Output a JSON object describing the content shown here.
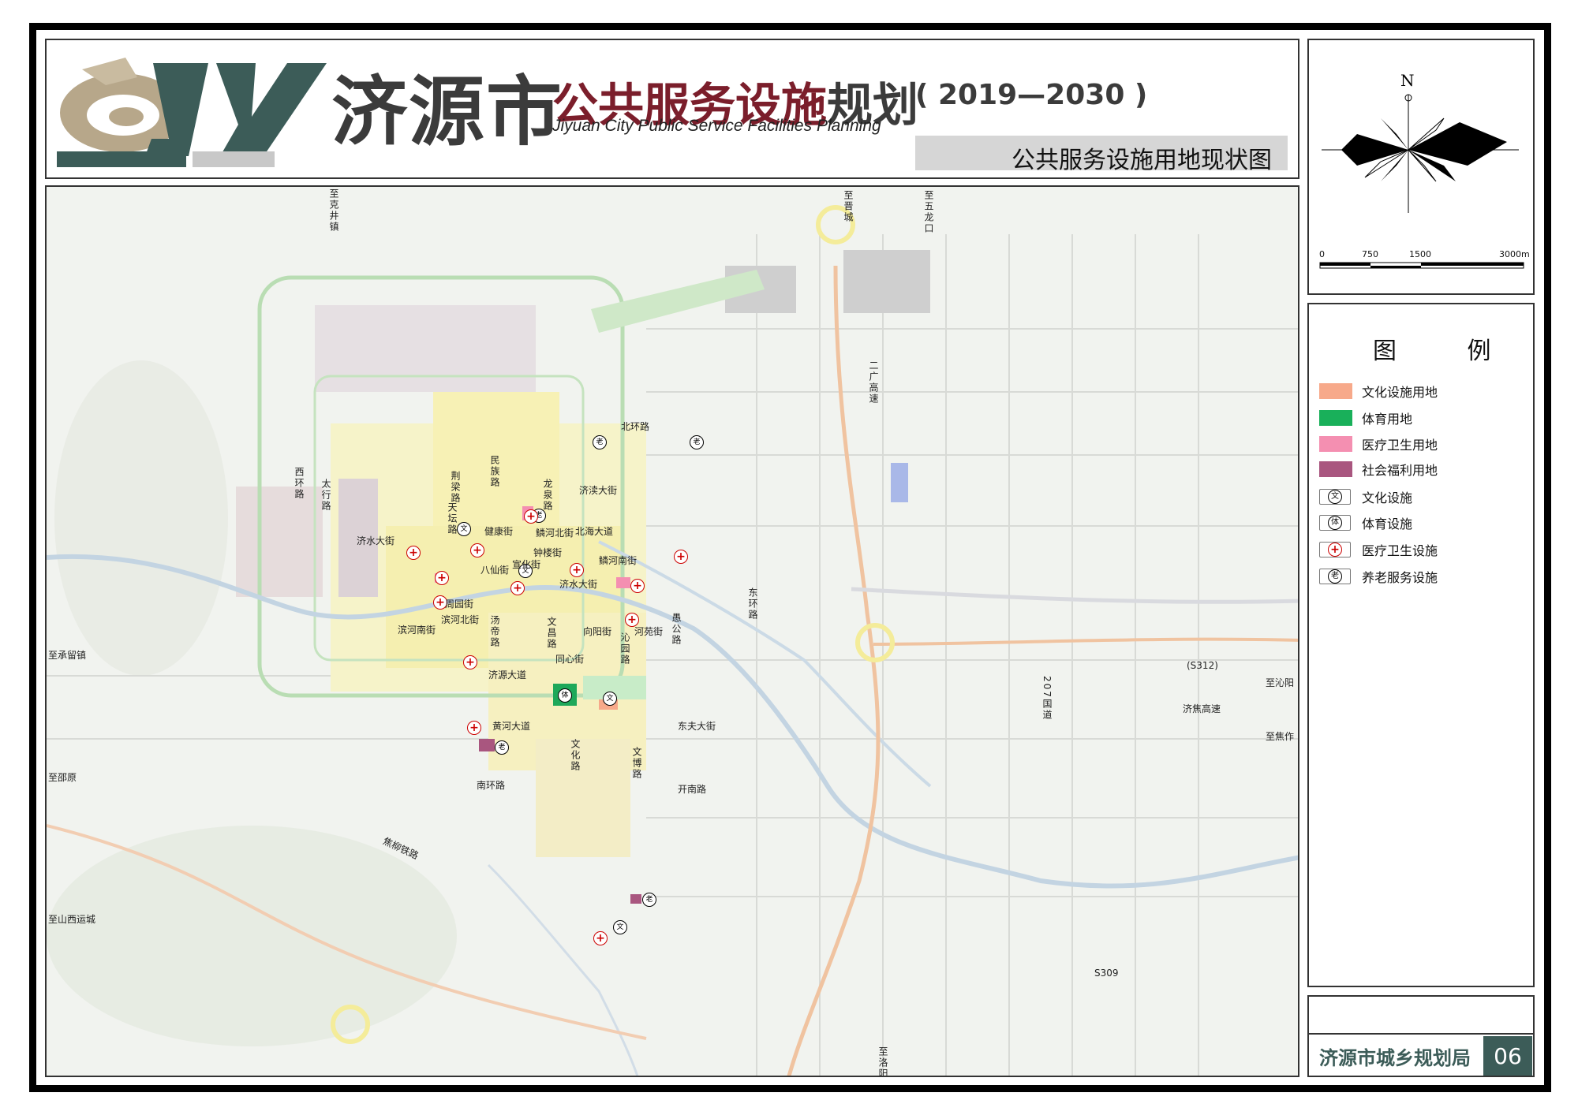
{
  "header": {
    "logo_text": "济源市",
    "title_main": "公共服务设施",
    "title_suffix": "规划",
    "title_years": "( 2019—2030 )",
    "title_en": "Jiyuan City Public Service Facilities Planning",
    "subtitle": "公共服务设施用地现状图"
  },
  "compass": {
    "north": "N",
    "scale_ticks": [
      "0",
      "750",
      "1500",
      "3000m"
    ]
  },
  "legend": {
    "title": "图 例",
    "items": [
      {
        "label": "文化设施用地",
        "color": "#f7a98a",
        "kind": "area"
      },
      {
        "label": "体育用地",
        "color": "#19b05a",
        "kind": "area"
      },
      {
        "label": "医疗卫生用地",
        "color": "#f48fb1",
        "kind": "area"
      },
      {
        "label": "社会福利用地",
        "color": "#a9567f",
        "kind": "area"
      },
      {
        "label": "文化设施",
        "glyph": "文",
        "kind": "symbol"
      },
      {
        "label": "体育设施",
        "glyph": "体",
        "kind": "symbol"
      },
      {
        "label": "医疗卫生设施",
        "glyph": "+",
        "kind": "symbol"
      },
      {
        "label": "养老服务设施",
        "glyph": "老",
        "kind": "symbol"
      }
    ]
  },
  "footer": {
    "agency": "济源市城乡规划局",
    "page_number": "06"
  },
  "map": {
    "labels": {
      "to_kejing": "至克井镇",
      "to_jincheng": "至晋城",
      "to_wulongkou": "至五龙口",
      "to_chengliu": "至承留镇",
      "to_qinyang": "至沁阳",
      "to_jiaozuo": "至焦作",
      "to_shaoyuan": "至邵原",
      "to_yuncheng": "至山西运城",
      "north_ring": "北环路",
      "south_ring": "南环路",
      "west_ring": "西环路",
      "east_ring": "东环路",
      "taihang": "太行路",
      "jishui": "济水大街",
      "jidu": "济渎大街",
      "beihai": "北海大道",
      "jiankang": "健康街",
      "zhonglou": "钟楼街",
      "bahe_n": "鳞河北街",
      "bahe_s": "鳞河南街",
      "xuanhua": "宣化街",
      "baxian": "八仙街",
      "jishui2": "济水大街",
      "binhe_n": "滨河北街",
      "binhe_s": "滨河南街",
      "zhouyuan": "周园街",
      "jiyuan": "济源大道",
      "huanghe": "黄河大道",
      "dongfu": "东夫大街",
      "kainan": "开南路",
      "xiangyang": "向阳街",
      "heyuan": "河苑街",
      "tongxin": "同心街",
      "qinyuan": "沁园路",
      "yugong": "愚公路",
      "wenchang": "文昌路",
      "tangdi": "汤帝路",
      "jingliang": "荆梁路",
      "wenhua": "文化路",
      "wenbo": "文博路",
      "minzu": "民族路",
      "longquan": "龙泉路",
      "tiantan": "天坛路",
      "ergun": "二广高速",
      "jijiao": "济焦高速",
      "s312": "(S312)",
      "s309": "S309",
      "g207": "207国道",
      "jiaoliu": "焦柳铁路",
      "to_luoyang": "至洛阳"
    }
  }
}
